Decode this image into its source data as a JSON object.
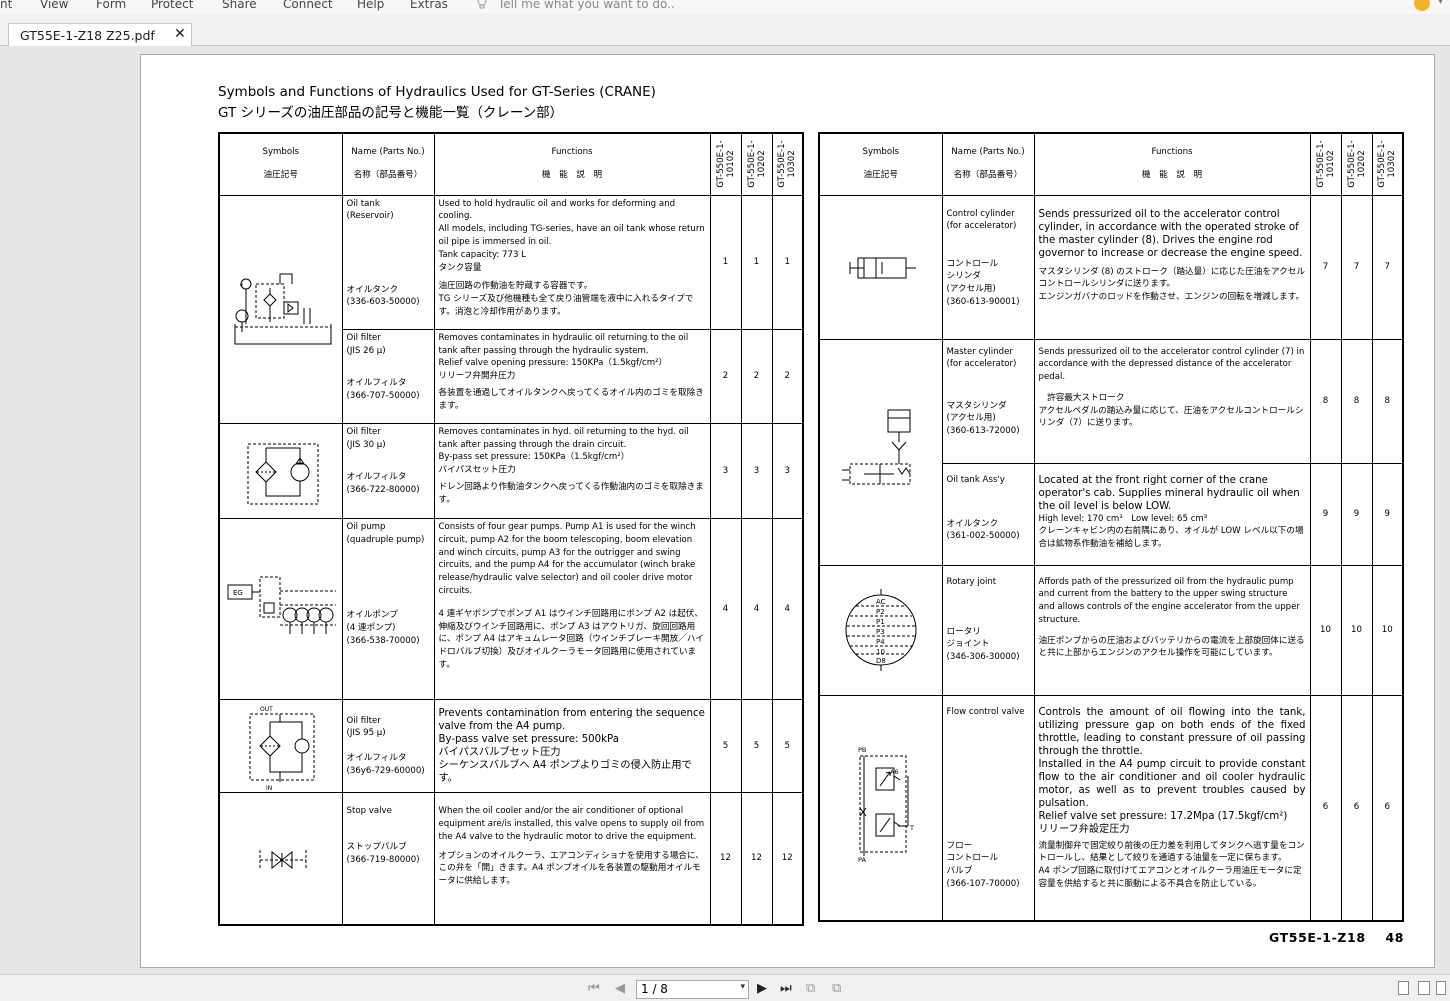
{
  "menubar": {
    "items": [
      "nt",
      "View",
      "Form",
      "Protect",
      "Share",
      "Connect",
      "Help",
      "Extras"
    ],
    "tell": "Tell me what you want to do.."
  },
  "tab": {
    "label": "GT55E-1-Z18 Z25.pdf",
    "close": "✕"
  },
  "page": {
    "title_en": "Symbols and Functions of Hydraulics Used for GT-Series (CRANE)",
    "title_ja": "GT シリーズの油圧部品の記号と機能一覧（クレーン部）",
    "headers": {
      "symbols": "Symbols",
      "symbols_ja": "油圧記号",
      "name": "Name (Parts No.)",
      "name_ja": "名称（部品番号）",
      "functions": "Functions",
      "functions_ja": "機　能　説　明",
      "models": [
        "GT-550E-1-\n10102",
        "GT-550E-1-\n10202",
        "GT-550E-1-\n10302"
      ]
    },
    "left_rows": [
      {
        "name_top": "Oil tank\n(Reservoir)",
        "name_bottom": "オイルタンク\n(336-603-50000)",
        "func": "Used to hold hydraulic oil and works for deforming and cooling.\nAll models, including TG-series, have an oil tank whose return oil pipe is immersed in oil.\nTank capacity: 773 L\nタンク容量",
        "func2": "油圧回路の作動油を貯蔵する容器です。\nTG シリーズ及び他機種も全て戻り油管端を液中に入れるタイプです。消泡と冷却作用があります。",
        "vals": [
          "1",
          "1",
          "1"
        ]
      },
      {
        "name_top": "Oil filter\n(JIS 26 μ)",
        "name_bottom": "オイルフィルタ\n(366-707-50000)",
        "func": "Removes contaminates in hydraulic oil returning to the oil tank after passing through the hydraulic system.\nRelief valve opening pressure: 150KPa（1.5kgf/cm²）\nリリーフ弁開弁圧力",
        "func2": "各装置を通過してオイルタンクへ戻ってくるオイル内のゴミを取除きます。",
        "vals": [
          "2",
          "2",
          "2"
        ]
      },
      {
        "name_top": "Oil filter\n(JIS 30 μ)",
        "name_bottom": "オイルフィルタ\n(366-722-80000)",
        "func": "Removes contaminates in hyd. oil returning to the hyd. oil tank after passing through the drain circuit.\nBy-pass set pressure: 150KPa（1.5kgf/cm²）\nバイパスセット圧力",
        "func2": "ドレン回路より作動油タンクへ戻ってくる作動油内のゴミを取除きます。",
        "vals": [
          "3",
          "3",
          "3"
        ]
      },
      {
        "name_top": "Oil pump\n(quadruple pump)",
        "name_bottom": "オイルポンプ\n(4 連ポンプ)\n(366-538-70000)",
        "func": "Consists of four gear pumps. Pump A1 is used for the winch circuit, pump A2 for the boom telescoping, boom elevation and winch circuits, pump A3 for the outrigger and swing circuits, and the pump A4 for the accumulator (winch brake release/hydraulic valve selector) and oil cooler drive motor circuits.",
        "func2": "4 連ギヤポンプでポンプ A1 はウインチ回路用にポンプ A2 は起伏、伸縮及びウインチ回路用に、ポンプ A3 はアウトリガ、旋回回路用に、ポンプ A4 はアキュムレータ回路（ウインチブレーキ開放／ハイドロバルブ切換）及びオイルクーラモータ回路用に使用されています。",
        "vals": [
          "4",
          "4",
          "4"
        ]
      },
      {
        "name_top": "Oil filter\n(JIS 95 μ)",
        "name_bottom": "オイルフィルタ\n(36y6-729-60000)",
        "func": "Prevents contamination from entering the sequence valve from the A4 pump.\nBy-pass valve set pressure: 500kPa\nバイパスバルブセット圧力\nシーケンスバルブへ A4 ポンプよりゴミの侵入防止用です。",
        "func2": "",
        "vals": [
          "5",
          "5",
          "5"
        ]
      },
      {
        "name_top": "Stop valve",
        "name_bottom": "ストップバルブ\n(366-719-80000)",
        "func": "When the oil cooler and/or the air conditioner of optional equipment are/is installed, this valve opens to supply oil from the A4 valve to the hydraulic motor to drive the equipment.",
        "func2": "オプションのオイルクーラ、エアコンディショナを使用する場合に、この弁を「開」きます。A4 ポンプオイルを各装置の駆動用オイルモータに供給します。",
        "vals": [
          "12",
          "12",
          "12"
        ]
      }
    ],
    "right_rows": [
      {
        "name_top": "Control cylinder\n(for accelerator)",
        "name_bottom": "コントロール\nシリンダ\n(アクセル用)\n(360-613-90001)",
        "func": "Sends pressurized oil to the accelerator control cylinder, in accordance with the operated stroke of the master cylinder (8). Drives the engine rod governor to increase or decrease the engine speed.",
        "func2": "マスタシリンダ (8) のストローク（踏込量）に応じた圧油をアクセルコントロールシリンダに送ります。\nエンジンガバナのロッドを作動させ、エンジンの回転を増減します。",
        "vals": [
          "7",
          "7",
          "7"
        ]
      },
      {
        "name_top": "Master cylinder\n(for accelerator)",
        "name_bottom": "マスタシリンダ\n(アクセル用)\n(360-613-72000)",
        "func": "Sends pressurized oil to the accelerator control cylinder (7) in accordance with the depressed distance of the accelerator pedal.",
        "func2": "　許容最大ストローク\nアクセルペダルの踏込み量に応じて、圧油をアクセルコントロールシリンダ（7）に送ります。",
        "vals": [
          "8",
          "8",
          "8"
        ]
      },
      {
        "name_top": "Oil tank Ass'y",
        "name_bottom": "オイルタンク\n(361-002-50000)",
        "func": "Located at the front right corner of the crane operator's cab. Supplies mineral hydraulic oil when the oil level is below LOW.",
        "func2": "High level: 170 cm³　Low level: 65 cm³\nクレーンキャビン内の右前隅にあり、オイルが LOW レベル以下の場合は鉱物系作動油を補給します。",
        "vals": [
          "9",
          "9",
          "9"
        ]
      },
      {
        "name_top": "Rotary joint",
        "name_bottom": "ロータリ\nジョイント\n(346-306-30000)",
        "func": "Affords path of the pressurized oil from the hydraulic pump and current from the battery to the upper swing structure and allows controls of the engine accelerator from the upper structure.",
        "func2": "油圧ポンプからの圧油およびバッテリからの電流を上部旋回体に送ると共に上部からエンジンのアクセル操作を可能にしています。",
        "vals": [
          "10",
          "10",
          "10"
        ]
      },
      {
        "name_top": "Flow control valve",
        "name_bottom": "フロー\nコントロール\nバルブ\n(366-107-70000)",
        "func": "Controls the amount of oil flowing into the tank, utilizing pressure gap on both ends of the fixed throttle, leading to constant pressure of oil passing through the throttle.\nInstalled in the A4 pump circuit to provide constant flow to the air conditioner and oil cooler hydraulic motor, as well as to prevent troubles caused by pulsation.\nRelief valve set pressure: 17.2Mpa (17.5kgf/cm²)\nリリーフ弁設定圧力",
        "func2": "流量制御弁で固定絞り前後の圧力差を利用してタンクへ逃す量をコントロールし、結果として絞りを通過する油量を一定に保ちます。\nA4 ポンプ回路に取付けてエアコンとオイルクーラ用油圧モータに定容量を供給すると共に脈動による不具合を防止している。",
        "vals": [
          "6",
          "6",
          "6"
        ]
      }
    ],
    "footer": {
      "code": "GT55E-1-Z18",
      "page_no": "48"
    },
    "symbol_labels": {
      "pump_eg": "EG",
      "out": "OUT",
      "in": "IN",
      "pb": "PB",
      "pa": "PA",
      "t": "T",
      "relief": "A6",
      "rotary": [
        "AC",
        "P2",
        "P1",
        "P3",
        "P4",
        "10",
        "D8"
      ]
    }
  },
  "nav": {
    "page_display": "1 / 8"
  }
}
